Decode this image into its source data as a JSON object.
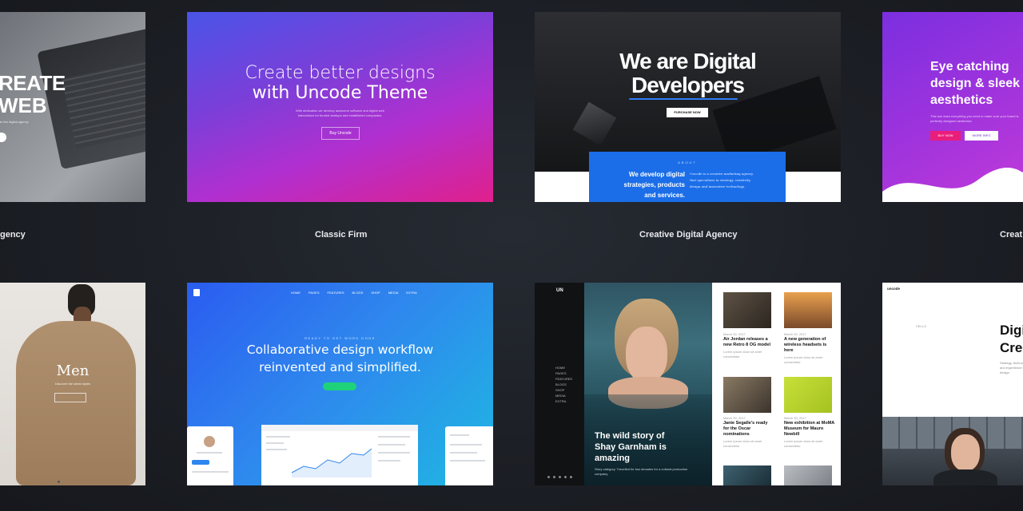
{
  "labels": {
    "col1": "gency",
    "col2": "Classic Firm",
    "col3": "Creative Digital Agency",
    "col4": "Creat"
  },
  "card1": {
    "line1": "REATE",
    "line2": "WEB",
    "tagline": "to the digital agency"
  },
  "card2": {
    "headline1": "Create better designs",
    "headline2": "with Uncode Theme",
    "body1": "With dedication we develop awesome software and digital web",
    "body2": "interactions for funded startups and established companies.",
    "button": "Buy Uncode"
  },
  "card3": {
    "headline1": "We are Digital",
    "headline2": "Developers",
    "button": "PURCHASE NOW",
    "panel_eyebrow": "ABOUT",
    "panel_title1": "We develop digital",
    "panel_title2": "strategies, products",
    "panel_title3": "and services.",
    "panel_body1": "Uncode is a creative marketing agency",
    "panel_body2": "that specializes in strategy, creativity,",
    "panel_body3": "design and innovative technology."
  },
  "card4": {
    "headline1": "Eye catching",
    "headline2": "design & sleek",
    "headline3": "aesthetics",
    "body": "This tool does everything you need to make sure your brand is perfectly designed aesthetics",
    "btn1": "BUY NOW",
    "btn2": "MORE INFO"
  },
  "card5": {
    "title": "Men",
    "sub": "Discover the latest styles"
  },
  "card6": {
    "nav": [
      "HOME",
      "PAGES",
      "FEATURES",
      "BLOGS",
      "SHOP",
      "MEDIA",
      "EXTRA"
    ],
    "eyebrow": "READY TO GET WORK DONE",
    "headline1": "Collaborative design workflow",
    "headline2": "reinvented and simplified."
  },
  "card7": {
    "logo": "UN",
    "menu": [
      "HOME",
      "PAGES",
      "FEATURES",
      "BLOGS",
      "SHOP",
      "MEDIA",
      "EXTRA"
    ],
    "feature1": "The wild story of",
    "feature2": "Shay Garnham is",
    "feature3": "amazing",
    "feature_body": "Story category. Travelled for two decades for a cultural production company.",
    "posts": [
      {
        "date": "March 30, 2017",
        "title": "Air Jordan releases a new Retro 8 OG model",
        "excerpt": "Lorem ipsum dolor sit amet consectetur"
      },
      {
        "date": "March 30, 2017",
        "title": "A new generation of wireless headsets is here",
        "excerpt": "Lorem ipsum dolor sit amet consectetur"
      },
      {
        "date": "March 30, 2017",
        "title": "Janie Segalle's ready for the Oscar nominations",
        "excerpt": "Lorem ipsum dolor sit amet consectetur"
      },
      {
        "date": "March 30, 2017",
        "title": "New exhibition at MoMA Museum for Mauro Newbill",
        "excerpt": "Lorem ipsum dolor sit amet consectetur"
      }
    ]
  },
  "card8": {
    "brand": "uncode",
    "hello": "HELLO",
    "headline1": "Digi",
    "headline2": "Cre",
    "body": "Strategy, technology and experience in design"
  },
  "colors": {
    "page_bg": "#1c1f25",
    "accent_blue": "#1e6ff0",
    "accent_pink": "#e91e7a"
  }
}
